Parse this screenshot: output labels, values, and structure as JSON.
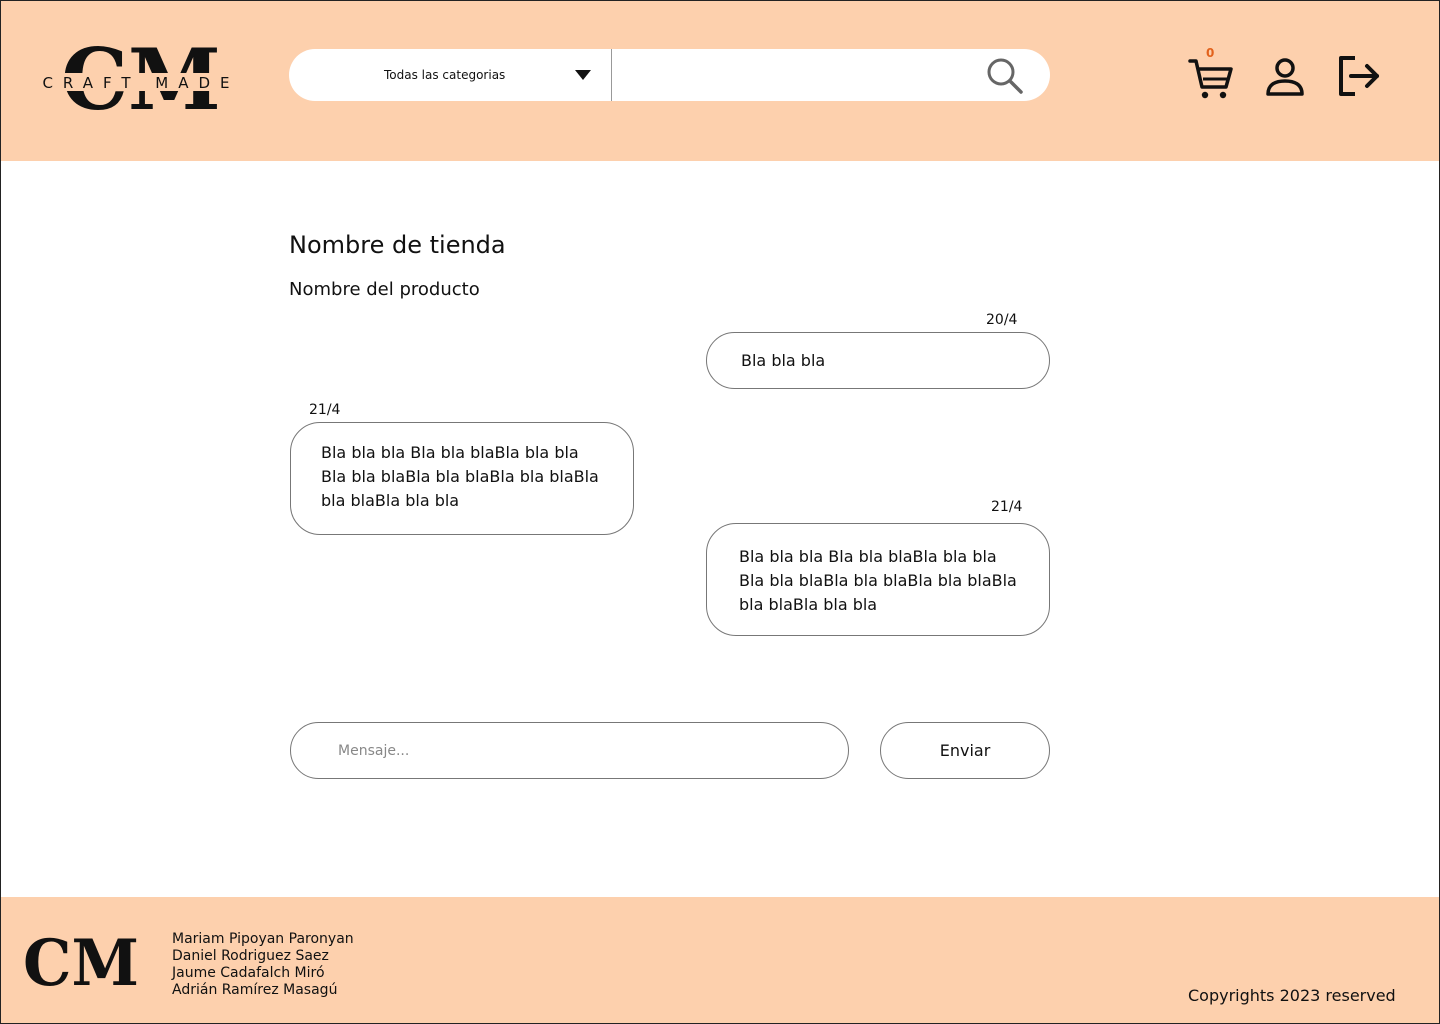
{
  "header": {
    "logo_text": "CRAFT MADE",
    "logo_mark": "CM",
    "category_select": "Todas las categorias",
    "search_value": "",
    "cart_count": "0",
    "icons": [
      "search-icon",
      "cart-icon",
      "user-icon",
      "logout-icon"
    ]
  },
  "main": {
    "store_name": "Nombre de tienda",
    "product_name": "Nombre del producto",
    "messages": [
      {
        "date": "20/4",
        "side": "right",
        "text": "Bla bla bla"
      },
      {
        "date": "21/4",
        "side": "left",
        "text": "Bla bla bla Bla bla blaBla bla bla Bla bla blaBla bla blaBla bla blaBla bla blaBla bla bla"
      },
      {
        "date": "21/4",
        "side": "right",
        "text": "Bla bla bla Bla bla blaBla bla bla Bla bla blaBla bla blaBla bla blaBla bla blaBla bla bla"
      }
    ],
    "composer": {
      "placeholder": "Mensaje...",
      "send_label": "Enviar"
    }
  },
  "footer": {
    "logo_mark": "CM",
    "authors": [
      "Mariam Pipoyan Paronyan",
      "Daniel Rodriguez Saez",
      "Jaume Cadafalch Miró",
      "Adrián Ramírez Masagú"
    ],
    "copyright": "Copyrights 2023 reserved"
  },
  "colors": {
    "brand_peach": "#fdd0ad",
    "cart_badge": "#e2621c",
    "text": "#111111"
  }
}
